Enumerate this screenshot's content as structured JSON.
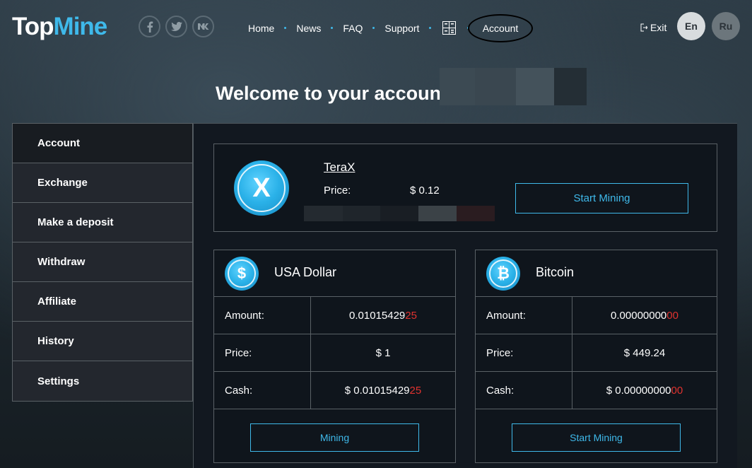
{
  "brand": {
    "logo_top": "Top",
    "logo_mine": "Mine"
  },
  "socials": [
    "f",
    "t",
    "vk"
  ],
  "nav": {
    "home": "Home",
    "news": "News",
    "faq": "FAQ",
    "support": "Support",
    "account": "Account",
    "exit": "Exit",
    "lang_en": "En",
    "lang_ru": "Ru"
  },
  "welcome": "Welcome to your account ,",
  "sidebar": {
    "items": [
      {
        "label": "Account"
      },
      {
        "label": "Exchange"
      },
      {
        "label": "Make a deposit"
      },
      {
        "label": "Withdraw"
      },
      {
        "label": "Affiliate"
      },
      {
        "label": "History"
      },
      {
        "label": "Settings"
      }
    ]
  },
  "terax": {
    "name": "TeraX",
    "price_label": "Price:",
    "price_value": "$ 0.12",
    "button": "Start Mining",
    "coin_glyph": "X"
  },
  "usd": {
    "title": "USA Dollar",
    "coin_glyph": "$",
    "amount_label": "Amount:",
    "amount_main": "0.01015429",
    "amount_tail": "25",
    "price_label": "Price:",
    "price_value": "$ 1",
    "cash_label": "Cash:",
    "cash_main": "$ 0.01015429",
    "cash_tail": "25",
    "button": "Mining"
  },
  "btc": {
    "title": "Bitcoin",
    "coin_glyph": "₿",
    "amount_label": "Amount:",
    "amount_main": "0.00000000",
    "amount_tail": "00",
    "price_label": "Price:",
    "price_value": "$ 449.24",
    "cash_label": "Cash:",
    "cash_main": "$ 0.00000000",
    "cash_tail": "00",
    "button": "Start Mining"
  },
  "colors": {
    "accent": "#3fb9ea",
    "red": "#e0322f"
  }
}
